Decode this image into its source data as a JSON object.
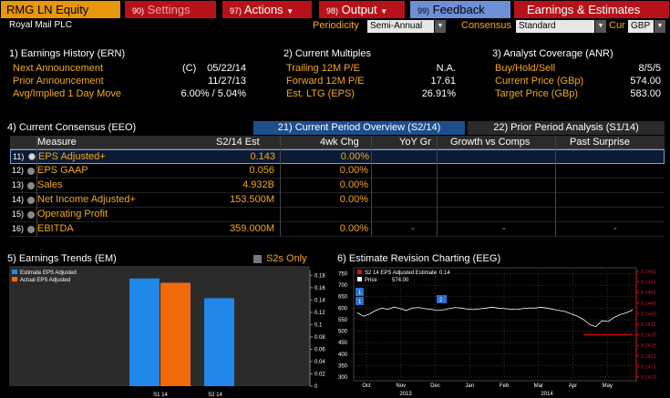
{
  "header": {
    "ticker": "RMG LN Equity",
    "buttons": [
      {
        "num": "90)",
        "label": "Settings"
      },
      {
        "num": "97)",
        "label": "Actions"
      },
      {
        "num": "98)",
        "label": "Output"
      },
      {
        "num": "99)",
        "label": "Feedback"
      },
      {
        "label": "Earnings & Estimates"
      }
    ],
    "company": "Royal Mail PLC",
    "periodicity_label": "Periodicity",
    "periodicity_value": "Semi-Annual",
    "consensus_label": "Consensus",
    "consensus_value": "Standard",
    "cur_label": "Cur",
    "cur_value": "GBP"
  },
  "earnings_history": {
    "title": "1) Earnings History (ERN)",
    "rows": [
      {
        "label": "Next Announcement",
        "prefix": "(C)",
        "value": "05/22/14"
      },
      {
        "label": "Prior Announcement",
        "value": "11/27/13"
      },
      {
        "label": "Avg/Implied 1 Day Move",
        "value": "6.00% / 5.04%"
      }
    ]
  },
  "current_multiples": {
    "title": "2) Current Multiples",
    "rows": [
      {
        "label": "Trailing 12M P/E",
        "value": "N.A."
      },
      {
        "label": "Forward 12M P/E",
        "value": "17.61"
      },
      {
        "label": "Est. LTG (EPS)",
        "value": "26.91%"
      }
    ]
  },
  "analyst_coverage": {
    "title": "3) Analyst Coverage (ANR)",
    "rows": [
      {
        "label": "Buy/Hold/Sell",
        "value": "8/5/5"
      },
      {
        "label": "Current Price (GBp)",
        "value": "574.00"
      },
      {
        "label": "Target Price (GBp)",
        "value": "583.00"
      }
    ]
  },
  "consensus": {
    "title": "4) Current Consensus (EEO)",
    "tab_active": "21) Current Period Overview (S2/14)",
    "tab_inactive": "22) Prior Period Analysis (S1/14)",
    "columns": [
      "Measure",
      "S2/14 Est",
      "4wk Chg",
      "YoY Gr",
      "Growth vs Comps",
      "Past Surprise"
    ],
    "rows": [
      {
        "num": "11)",
        "measure": "EPS Adjusted+",
        "est": "0.143",
        "chg": "0.00%",
        "yoy": "",
        "comps": "",
        "surprise": ""
      },
      {
        "num": "12)",
        "measure": "EPS GAAP",
        "est": "0.056",
        "chg": "0.00%",
        "yoy": "",
        "comps": "",
        "surprise": ""
      },
      {
        "num": "13)",
        "measure": "Sales",
        "est": "4.932B",
        "chg": "0.00%",
        "yoy": "",
        "comps": "",
        "surprise": ""
      },
      {
        "num": "14)",
        "measure": "Net Income Adjusted+",
        "est": "153.500M",
        "chg": "0.00%",
        "yoy": "",
        "comps": "",
        "surprise": ""
      },
      {
        "num": "15)",
        "measure": "Operating Profit",
        "est": "",
        "chg": "",
        "yoy": "",
        "comps": "",
        "surprise": ""
      },
      {
        "num": "16)",
        "measure": "EBITDA",
        "est": "359.000M",
        "chg": "0.00%",
        "yoy": "-",
        "comps": "-",
        "surprise": "-"
      }
    ]
  },
  "trends": {
    "title": "5) Earnings Trends (EM)",
    "toggle_label": "S2s Only",
    "legend": [
      {
        "name": "Estimate EPS Adjusted",
        "color": "#1f88e8"
      },
      {
        "name": "Actual EPS Adjusted",
        "color": "#f06a0a"
      }
    ]
  },
  "revision": {
    "title": "6) Estimate Revision Charting (EEG)",
    "legend": [
      {
        "name": "S2 14 EPS Adjusted Estimate",
        "value": "0.14",
        "color": "#d0131a"
      },
      {
        "name": "Price",
        "value": "574.00",
        "color": "#ffffff"
      }
    ],
    "markers": [
      "1",
      "1",
      "2"
    ]
  },
  "chart_data": [
    {
      "type": "bar",
      "categories": [
        "S1 14",
        "S2 14"
      ],
      "series": [
        {
          "name": "Estimate EPS Adjusted",
          "values": [
            0.175,
            0.143
          ]
        },
        {
          "name": "Actual EPS Adjusted",
          "values": [
            0.168,
            null
          ]
        }
      ],
      "yticks": [
        "0.18",
        "0.16",
        "0.14",
        "0.12",
        "0.1",
        "0.08",
        "0.06",
        "0.04",
        "0.02",
        "0"
      ],
      "ylim": [
        0,
        0.185
      ],
      "legend": "top-left",
      "grid": false
    },
    {
      "type": "line",
      "x_labels": [
        "Oct",
        "Nov",
        "Dec",
        "Jan",
        "Feb",
        "Mar",
        "Apr",
        "May"
      ],
      "year_labels": [
        "2013",
        "2014"
      ],
      "left_yticks": [
        "750",
        "700",
        "650",
        "600",
        "550",
        "500",
        "450",
        "400",
        "350",
        "300"
      ],
      "right_yticks": [
        "0.1460",
        "0.1455",
        "0.1450",
        "0.1445",
        "0.1440",
        "0.1435",
        "0.1430",
        "0.1425",
        "0.1420",
        "0.1415",
        "0.1410"
      ],
      "left_ylim": [
        300,
        760
      ],
      "right_ylim": [
        0.141,
        0.146
      ],
      "series": [
        {
          "name": "Price",
          "axis": "left",
          "values": [
            580,
            565,
            575,
            590,
            600,
            595,
            605,
            598,
            590,
            600,
            603,
            598,
            595,
            590,
            592,
            598,
            603,
            600,
            596,
            594,
            597,
            600,
            604,
            600,
            598,
            596,
            594,
            598,
            601,
            600,
            604,
            600,
            595,
            590,
            585,
            575,
            565,
            550,
            528,
            520,
            545,
            542,
            560,
            572,
            580,
            592
          ]
        },
        {
          "name": "S2 14 EPS Adjusted Estimate",
          "axis": "right",
          "values": [
            null,
            null,
            null,
            null,
            null,
            null,
            null,
            null,
            null,
            null,
            null,
            null,
            null,
            null,
            null,
            null,
            null,
            null,
            null,
            null,
            null,
            null,
            null,
            null,
            null,
            null,
            null,
            null,
            null,
            null,
            null,
            null,
            null,
            null,
            null,
            null,
            null,
            0.143,
            0.143,
            0.143,
            0.143,
            0.143,
            0.143,
            0.143,
            0.143,
            0.143
          ]
        }
      ],
      "legend": "top-left",
      "grid": true
    }
  ]
}
